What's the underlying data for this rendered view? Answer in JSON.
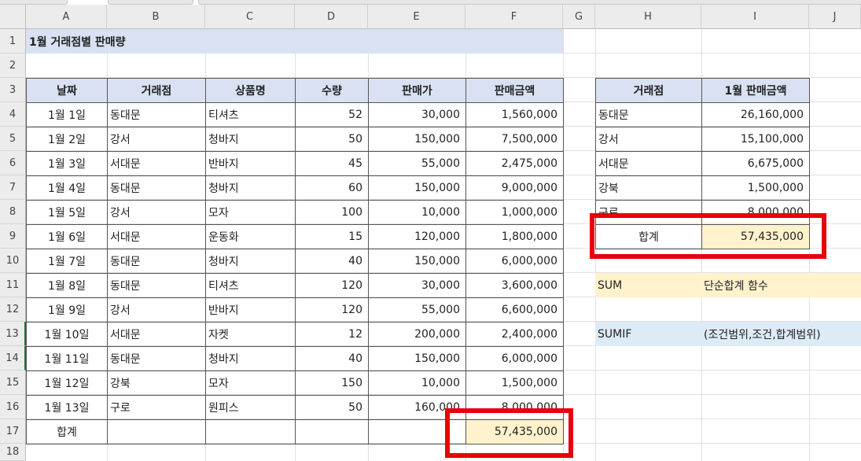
{
  "columns": [
    "A",
    "B",
    "C",
    "D",
    "E",
    "F",
    "G",
    "H",
    "I",
    "J"
  ],
  "rows": [
    "1",
    "2",
    "3",
    "4",
    "5",
    "6",
    "7",
    "8",
    "9",
    "10",
    "11",
    "12",
    "13",
    "14",
    "15",
    "16",
    "17",
    "18"
  ],
  "title": "1월 거래점별 판매량",
  "main_table": {
    "headers": [
      "날짜",
      "거래점",
      "상품명",
      "수량",
      "판매가",
      "판매금액"
    ],
    "rows": [
      [
        "1월 1일",
        "동대문",
        "티셔츠",
        "52",
        "30,000",
        "1,560,000"
      ],
      [
        "1월 2일",
        "강서",
        "청바지",
        "50",
        "150,000",
        "7,500,000"
      ],
      [
        "1월 3일",
        "서대문",
        "반바지",
        "45",
        "55,000",
        "2,475,000"
      ],
      [
        "1월 4일",
        "동대문",
        "청바지",
        "60",
        "150,000",
        "9,000,000"
      ],
      [
        "1월 5일",
        "강서",
        "모자",
        "100",
        "10,000",
        "1,000,000"
      ],
      [
        "1월 6일",
        "서대문",
        "운동화",
        "15",
        "120,000",
        "1,800,000"
      ],
      [
        "1월 7일",
        "동대문",
        "청바지",
        "40",
        "150,000",
        "6,000,000"
      ],
      [
        "1월 8일",
        "동대문",
        "티셔츠",
        "120",
        "30,000",
        "3,600,000"
      ],
      [
        "1월 9일",
        "강서",
        "반바지",
        "120",
        "55,000",
        "6,600,000"
      ],
      [
        "1월 10일",
        "서대문",
        "자켓",
        "12",
        "200,000",
        "2,400,000"
      ],
      [
        "1월 11일",
        "동대문",
        "청바지",
        "40",
        "150,000",
        "6,000,000"
      ],
      [
        "1월 12일",
        "강북",
        "모자",
        "150",
        "10,000",
        "1,500,000"
      ],
      [
        "1월 13일",
        "구로",
        "원피스",
        "50",
        "160,000",
        "8,000,000"
      ]
    ],
    "total_label": "합계",
    "total_value": "57,435,000"
  },
  "summary_table": {
    "headers": [
      "거래점",
      "1월 판매금액"
    ],
    "rows": [
      [
        "동대문",
        "26,160,000"
      ],
      [
        "강서",
        "15,100,000"
      ],
      [
        "서대문",
        "6,675,000"
      ],
      [
        "강북",
        "1,500,000"
      ],
      [
        "구로",
        "8,000,000"
      ]
    ],
    "total_label": "합계",
    "total_value": "57,435,000"
  },
  "notes": {
    "sum_name": "SUM",
    "sum_desc": "단순합계 함수",
    "sumif_name": "SUMIF",
    "sumif_desc": "(조건범위,조건,합계범위)"
  },
  "colors": {
    "header_fill": "#d9e1f2",
    "total_fill": "#fff2cc",
    "sumif_fill": "#ddebf7",
    "highlight_box": "#e8000b",
    "selected_row_marker": "#217346"
  }
}
